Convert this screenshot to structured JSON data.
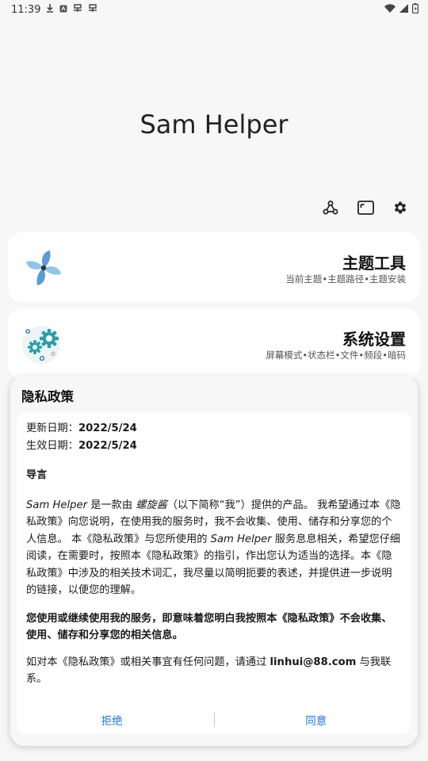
{
  "status_bar": {
    "time": "11:39",
    "icons_left": [
      "download-icon",
      "app-icon",
      "pattern-icon",
      "pattern-icon"
    ],
    "icons_right": [
      "wifi-icon",
      "signal-icon",
      "battery-icon"
    ]
  },
  "app": {
    "title": "Sam Helper"
  },
  "toolbar": {
    "icons": [
      "tools-icon",
      "window-icon",
      "settings-icon"
    ]
  },
  "cards": [
    {
      "title": "主题工具",
      "subtitle": "当前主题•主题路径•主题安装",
      "icon": "pinwheel-icon"
    },
    {
      "title": "系统设置",
      "subtitle": "屏幕模式•状态栏•文件•频段•暗码",
      "icon": "gears-icon"
    }
  ],
  "dialog": {
    "title": "隐私政策",
    "update_label": "更新日期：",
    "update_date": "2022/5/24",
    "effective_label": "生效日期：",
    "effective_date": "2022/5/24",
    "intro_heading": "导言",
    "para1_app": "Sam Helper",
    "para1_a": " 是一款由 ",
    "para1_author": "螺旋酱",
    "para1_b": "（以下简称“我”）提供的产品。 我希望通过本《隐私政策》向您说明，在使用我的服务时，我不会收集、使用、储存和分享您的个人信息。 本《隐私政策》与您所使用的 ",
    "para1_app2": "Sam Helper",
    "para1_c": " 服务息息相关，希望您仔细阅读，在需要时，按照本《隐私政策》的指引，作出您认为适当的选择。本《隐私政策》中涉及的相关技术词汇，我尽量以简明扼要的表述，并提供进一步说明的链接，以便您的理解。",
    "para2": "您使用或继续使用我的服务，即意味着您明白我按照本《隐私政策》不会收集、使用、储存和分享您的相关信息。",
    "para3_a": "如对本《隐私政策》或相关事宜有任何问题，请通过 ",
    "contact_email": "linhui@88.com",
    "para3_b": " 与我联系。",
    "reject_label": "拒绝",
    "agree_label": "同意"
  },
  "colors": {
    "accent": "#1a73e8",
    "background": "#f7f7f7",
    "card": "#ffffff",
    "pinwheel_blue": "#5b9bd5",
    "gear_teal": "#2a9fa8"
  }
}
